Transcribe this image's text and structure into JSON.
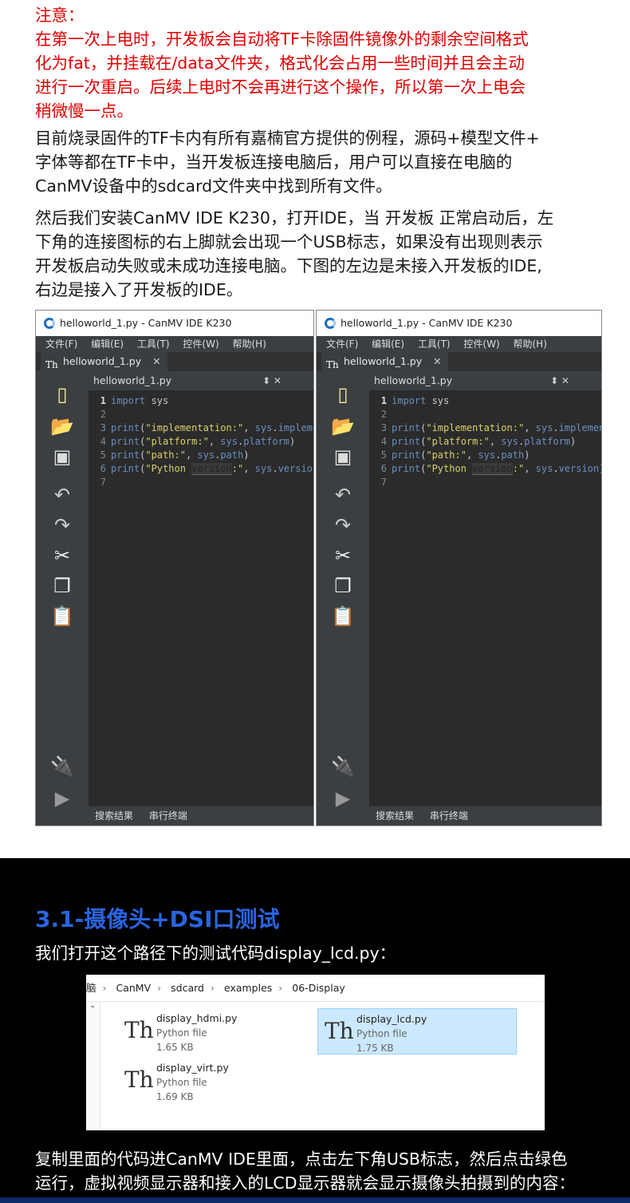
{
  "note": {
    "heading": "注意：",
    "lines": [
      "在第一次上电时，开发板会自动将TF卡除固件镜像外的剩余空间格式",
      "化为fat，并挂载在/data文件夹，格式化会占用一些时间并且会主动",
      "进行一次重启。后续上电时不会再进行这个操作，所以第一次上电会",
      "稍微慢一点。"
    ]
  },
  "paragraph1": [
    "目前烧录固件的TF卡内有所有嘉楠官方提供的例程，源码+模型文件+",
    "字体等都在TF卡中，当开发板连接电脑后，用户可以直接在电脑的",
    "CanMV设备中的sdcard文件夹中找到所有文件。"
  ],
  "paragraph2": [
    "然后我们安装CanMV IDE K230，打开IDE，当 开发板 正常启动后，左",
    "下角的连接图标的右上脚就会出现一个USB标志，如果没有出现则表示",
    "开发板启动失败或未成功连接电脑。下图的左边是未接入开发板的IDE,",
    "右边是接入了开发板的IDE。"
  ],
  "ide": {
    "window_title": "helloworld_1.py - CanMV IDE K230",
    "menu": [
      "文件(F)",
      "编辑(E)",
      "工具(T)",
      "控件(W)",
      "帮助(H)"
    ],
    "tab_label": "helloworld_1.py",
    "tab_close": "✕",
    "file_header": "helloworld_1.py",
    "file_header_controls": "⬍  ✕",
    "status_items": [
      "搜索结果",
      "串行终端"
    ],
    "icons_left": [
      "new-file-icon",
      "open-folder-icon",
      "save-icon",
      "undo-icon",
      "redo-icon",
      "cut-icon",
      "copy-icon",
      "paste-icon",
      "connect-icon",
      "run-icon"
    ]
  },
  "code_lines": [
    {
      "n": "1",
      "parts": [
        [
          "kw",
          "import"
        ],
        [
          "pl",
          " sys"
        ]
      ]
    },
    {
      "n": "2",
      "parts": []
    },
    {
      "n": "3",
      "parts": [
        [
          "fn",
          "print"
        ],
        [
          "pl",
          "("
        ],
        [
          "str",
          "\"implementation:\""
        ],
        [
          "pl",
          ", "
        ],
        [
          "kw",
          "sys"
        ],
        [
          "pl",
          "."
        ],
        [
          "kw",
          "implementation"
        ],
        [
          "pl",
          ")"
        ]
      ]
    },
    {
      "n": "4",
      "parts": [
        [
          "fn",
          "print"
        ],
        [
          "pl",
          "("
        ],
        [
          "str",
          "\"platform:\""
        ],
        [
          "pl",
          ", "
        ],
        [
          "kw",
          "sys"
        ],
        [
          "pl",
          "."
        ],
        [
          "kw",
          "platform"
        ],
        [
          "pl",
          ")"
        ]
      ]
    },
    {
      "n": "5",
      "parts": [
        [
          "fn",
          "print"
        ],
        [
          "pl",
          "("
        ],
        [
          "str",
          "\"path:\""
        ],
        [
          "pl",
          ", "
        ],
        [
          "kw",
          "sys"
        ],
        [
          "pl",
          "."
        ],
        [
          "kw",
          "path"
        ],
        [
          "pl",
          ")"
        ]
      ]
    },
    {
      "n": "6",
      "parts": [
        [
          "fn",
          "print"
        ],
        [
          "pl",
          "("
        ],
        [
          "str",
          "\"Python "
        ],
        [
          "hl",
          "version"
        ],
        [
          "str",
          ":\""
        ],
        [
          "pl",
          ", "
        ],
        [
          "kw",
          "sys"
        ],
        [
          "pl",
          "."
        ],
        [
          "kw",
          "version"
        ],
        [
          "pl",
          ")"
        ]
      ]
    },
    {
      "n": "7",
      "parts": []
    }
  ],
  "section": {
    "title": "3.1-摄像头+DSI口测试",
    "intro": "我们打开这个路径下的测试代码display_lcd.py：",
    "outro": [
      "复制里面的代码进CanMV IDE里面，点击左下角USB标志，然后点击绿色",
      "运行，虚拟视频显示器和接入的LCD显示器就会显示摄像头拍摄到的内容："
    ]
  },
  "explorer": {
    "breadcrumb": [
      "脑",
      "CanMV",
      "sdcard",
      "examples",
      "06-Display"
    ],
    "files": [
      {
        "name": "display_hdmi.py",
        "type": "Python file",
        "size": "1.65 KB",
        "selected": false
      },
      {
        "name": "display_lcd.py",
        "type": "Python file",
        "size": "1.75 KB",
        "selected": true
      },
      {
        "name": "display_virt.py",
        "type": "Python file",
        "size": "1.69 KB",
        "selected": false
      }
    ]
  },
  "colors": {
    "note_text": "#e00000",
    "section_title": "#2a64e0",
    "ide_bg": "#3c3f41",
    "editor_bg": "#2b2b2b",
    "selection": "#cce8ff"
  }
}
